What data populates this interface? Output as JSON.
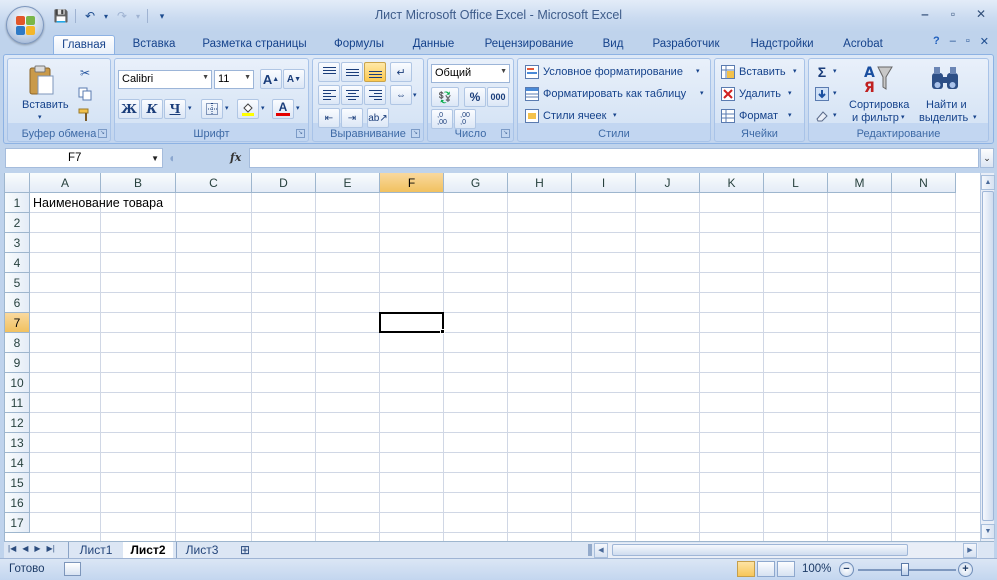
{
  "window": {
    "title": "Лист Microsoft Office Excel - Microsoft Excel"
  },
  "qat": {
    "save": "💾",
    "undo": "↶",
    "redo": "↷",
    "customize": "▾"
  },
  "tabs": [
    "Главная",
    "Вставка",
    "Разметка страницы",
    "Формулы",
    "Данные",
    "Рецензирование",
    "Вид",
    "Разработчик",
    "Надстройки",
    "Acrobat"
  ],
  "ribbon": {
    "clipboard": {
      "label": "Буфер обмена",
      "paste": "Вставить"
    },
    "font": {
      "label": "Шрифт",
      "name": "Calibri",
      "size": "11",
      "bold": "Ж",
      "italic": "К",
      "underline": "Ч",
      "grow": "A",
      "shrink": "A",
      "color_letter": "A"
    },
    "alignment": {
      "label": "Выравнивание"
    },
    "number": {
      "label": "Число",
      "format": "Общий",
      "percent": "%",
      "thousands": "000",
      "inc_decimal": ",0\n,00",
      "dec_decimal": ",00\n,0"
    },
    "styles": {
      "label": "Стили",
      "conditional": "Условное форматирование",
      "as_table": "Форматировать как таблицу",
      "cell_styles": "Стили ячеек"
    },
    "cells": {
      "label": "Ячейки",
      "insert": "Вставить",
      "delete": "Удалить",
      "format": "Формат"
    },
    "editing": {
      "label": "Редактирование",
      "sum": "Σ",
      "sort_line1": "Сортировка",
      "sort_line2": "и фильтр",
      "find_line1": "Найти и",
      "find_line2": "выделить"
    }
  },
  "formula_bar": {
    "name_box": "F7",
    "fx": "fx",
    "value": ""
  },
  "grid": {
    "columns": [
      "A",
      "B",
      "C",
      "D",
      "E",
      "F",
      "G",
      "H",
      "I",
      "J",
      "K",
      "L",
      "M",
      "N"
    ],
    "rows": [
      "1",
      "2",
      "3",
      "4",
      "5",
      "6",
      "7",
      "8",
      "9",
      "10",
      "11",
      "12",
      "13",
      "14",
      "15",
      "16",
      "17"
    ],
    "selected_column": "F",
    "selected_row": "7",
    "cells": {
      "A1": "Наименование товара"
    }
  },
  "sheets": [
    "Лист1",
    "Лист2",
    "Лист3"
  ],
  "active_sheet": "Лист2",
  "status": {
    "ready": "Готово",
    "zoom": "100%"
  },
  "colors": {
    "accent": "#15428b",
    "selection": "#f1c15f",
    "grid_line": "#d0d7e5"
  }
}
